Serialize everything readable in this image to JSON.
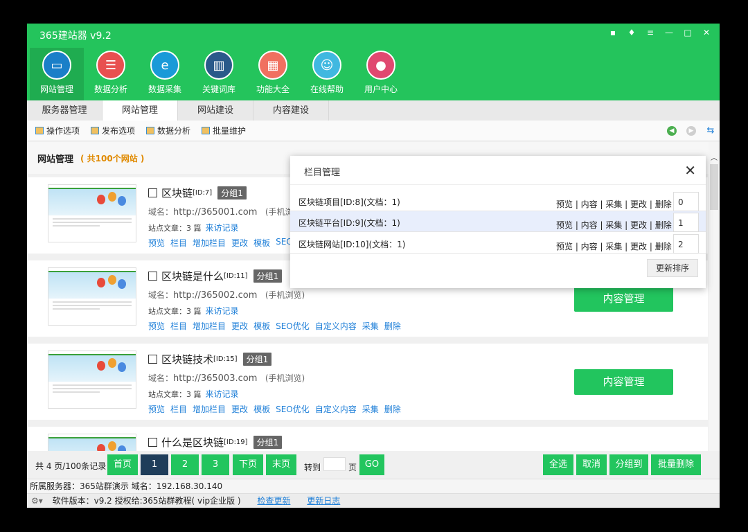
{
  "app": {
    "title": "365建站器 v9.2"
  },
  "nav": [
    {
      "label": "网站管理",
      "icon": "monitor-icon",
      "color": "#1a7fc8"
    },
    {
      "label": "数据分析",
      "icon": "database-icon",
      "color": "#e85050"
    },
    {
      "label": "数据采集",
      "icon": "browser-icon",
      "color": "#1a9ad8"
    },
    {
      "label": "关键词库",
      "icon": "book-icon",
      "color": "#2a5a8a"
    },
    {
      "label": "功能大全",
      "icon": "grid-icon",
      "color": "#f07060"
    },
    {
      "label": "在线帮助",
      "icon": "support-icon",
      "color": "#40b8e0"
    },
    {
      "label": "用户中心",
      "icon": "user-icon",
      "color": "#e04870"
    }
  ],
  "tabs": [
    "服务器管理",
    "网站管理",
    "网站建设",
    "内容建设"
  ],
  "toolbar": [
    "操作选项",
    "发布选项",
    "数据分析",
    "批量维护"
  ],
  "section": {
    "title": "网站管理",
    "count": "( 共100个网站 )"
  },
  "sites": [
    {
      "name": "区块链",
      "id": "[ID:7]",
      "group": "分组1",
      "domain_label": "域名：",
      "domain": "http://365001.com",
      "mobile": "(手机浏览)",
      "articles": "站点文章：3 篇",
      "visit": "来访记录"
    },
    {
      "name": "区块链是什么",
      "id": "[ID:11]",
      "group": "分组1",
      "domain_label": "域名：",
      "domain": "http://365002.com",
      "mobile": "(手机浏览)",
      "articles": "站点文章：3 篇",
      "visit": "来访记录"
    },
    {
      "name": "区块链技术",
      "id": "[ID:15]",
      "group": "分组1",
      "domain_label": "域名：",
      "domain": "http://365003.com",
      "mobile": "(手机浏览)",
      "articles": "站点文章：3 篇",
      "visit": "来访记录"
    },
    {
      "name": "什么是区块链",
      "id": "[ID:19]",
      "group": "分组1"
    }
  ],
  "site_links": [
    "预览",
    "栏目",
    "增加栏目",
    "更改",
    "模板",
    "SEO优化",
    "自定义内容",
    "采集",
    "删除"
  ],
  "site_links_short": [
    "预览",
    "栏目",
    "增加栏目",
    "更改",
    "模板",
    "SEO"
  ],
  "manage_button": "内容管理",
  "pager": {
    "info": "共 4 页/100条记录",
    "first": "首页",
    "pages": [
      "1",
      "2",
      "3"
    ],
    "next": "下页",
    "last": "末页",
    "goto": "转到",
    "page_unit": "页",
    "go": "GO",
    "select_all": "全选",
    "cancel": "取消",
    "group_to": "分组到",
    "batch_delete": "批量删除"
  },
  "status": {
    "server": "所属服务器：365站群演示 域名：192.168.30.140",
    "version": "软件版本：v9.2  授权给:365站群教程( vip企业版 )",
    "check_update": "检查更新",
    "update_log": "更新日志"
  },
  "dialog": {
    "title": "栏目管理",
    "close": "✕",
    "rows": [
      {
        "name": "区块链项目[ID:8](文档：1)",
        "order": "0"
      },
      {
        "name": "区块链平台[ID:9](文档：1)",
        "order": "1"
      },
      {
        "name": "区块链网站[ID:10](文档：1)",
        "order": "2"
      }
    ],
    "actions": "预览 | 内容 | 采集 | 更改 | 删除",
    "update_order": "更新排序"
  }
}
